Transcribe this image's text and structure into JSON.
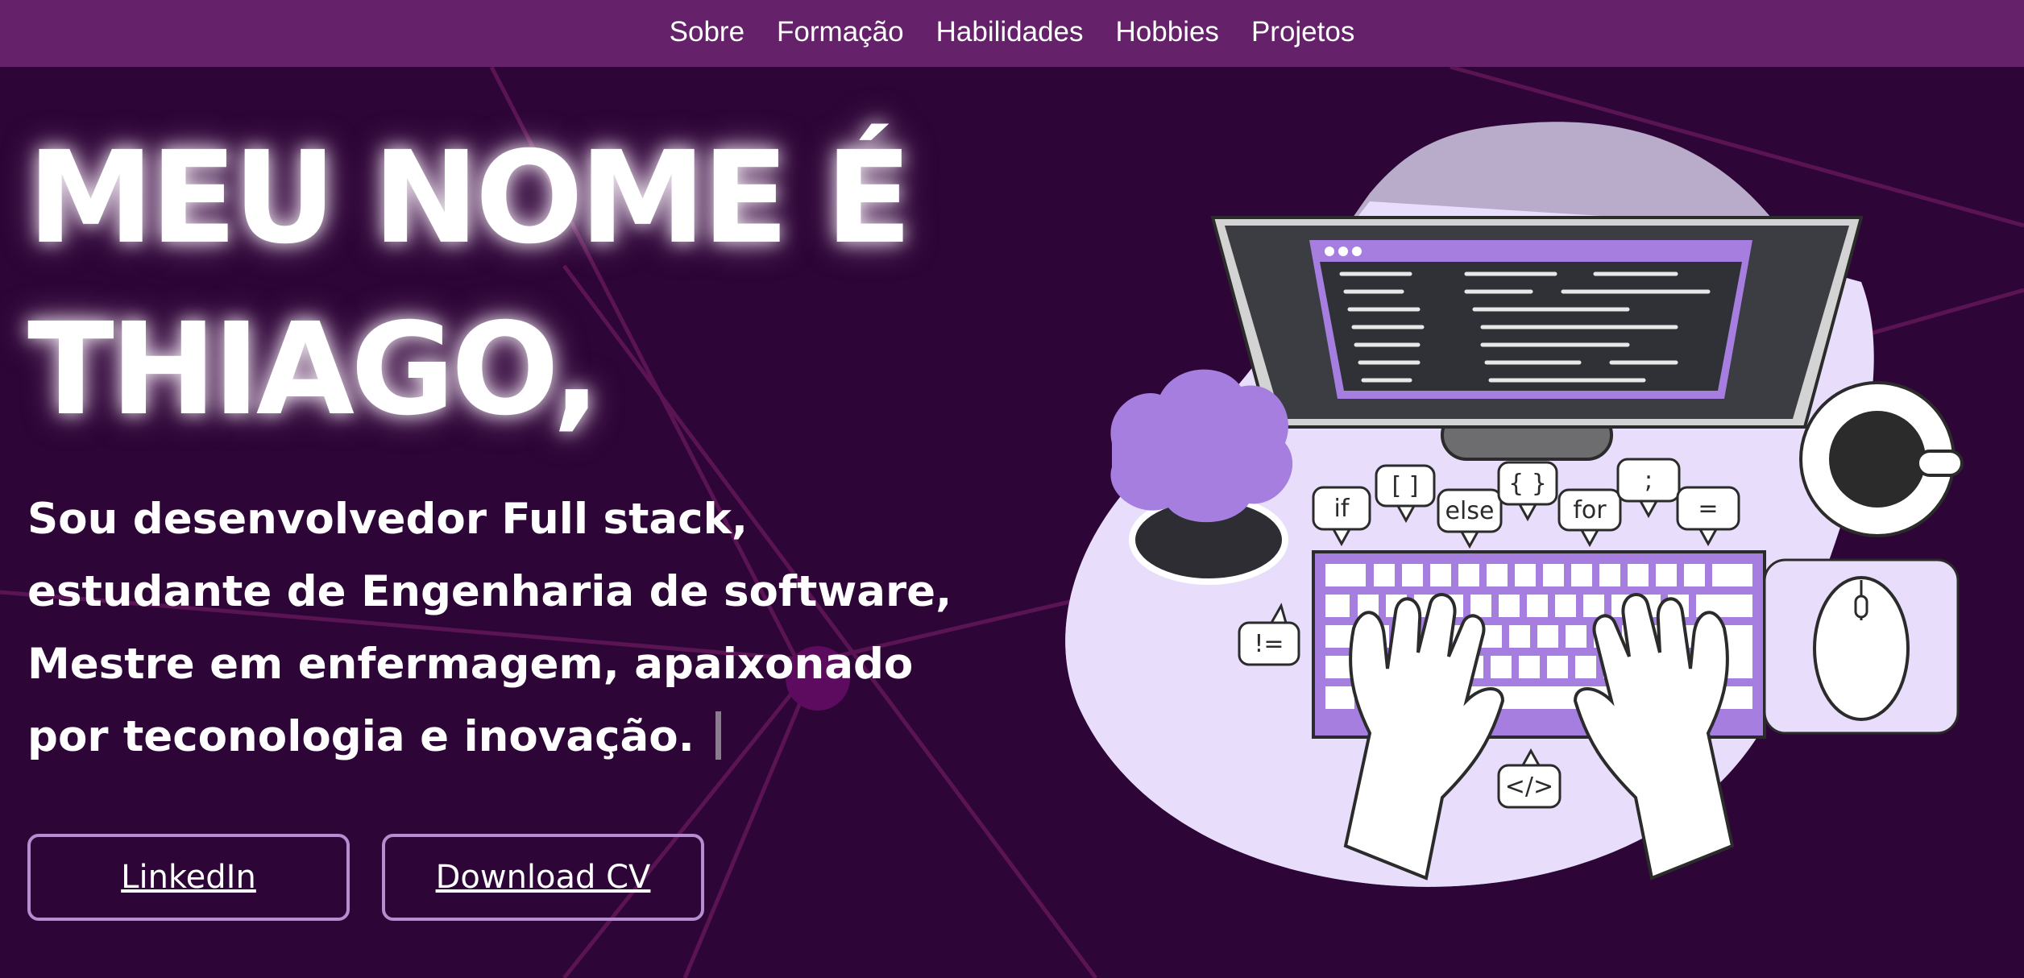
{
  "nav": {
    "items": [
      {
        "label": "Sobre"
      },
      {
        "label": "Formação"
      },
      {
        "label": "Habilidades"
      },
      {
        "label": "Hobbies"
      },
      {
        "label": "Projetos"
      }
    ]
  },
  "hero": {
    "title_line1": "MEU NOME É",
    "title_line2": "THIAGO,",
    "subtitle_lines": [
      "Sou desenvolvedor Full stack,",
      "estudante de Engenharia de software,",
      "Mestre em enfermagem, apaixonado",
      "por teconologia e inovação."
    ]
  },
  "buttons": {
    "linkedin": "LinkedIn",
    "cv": "Download CV"
  },
  "illustration": {
    "bubbles": [
      "if",
      "[ ]",
      "else",
      "{ }",
      "for",
      ";",
      "=",
      "!=",
      "</>"
    ]
  },
  "colors": {
    "background": "#2d0536",
    "nav": "#65226a",
    "accent": "#a57ee0",
    "button_border": "#b58dd0"
  }
}
